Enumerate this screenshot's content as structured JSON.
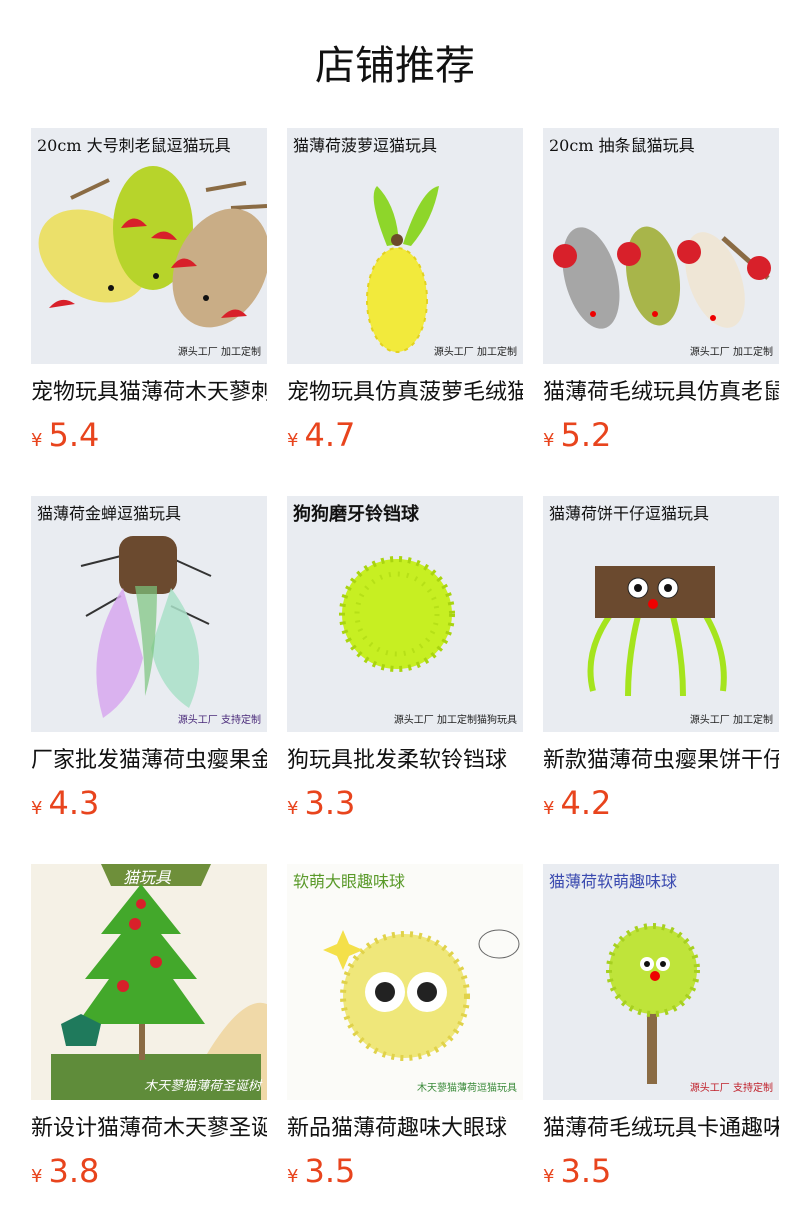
{
  "header": {
    "title": "店铺推荐"
  },
  "currency": "¥",
  "products": [
    {
      "caption": "20cm 大号刺老鼠逗猫玩具",
      "watermark": "源头工厂 加工定制",
      "name": "宠物玩具猫薄荷木天蓼刺老鼠",
      "price": "5.4",
      "icon": "hedgehog-mice-image"
    },
    {
      "caption": "猫薄荷菠萝逗猫玩具",
      "watermark": "源头工厂 加工定制",
      "name": "宠物玩具仿真菠萝毛绒猫薄荷",
      "price": "4.7",
      "icon": "pineapple-toy-image"
    },
    {
      "caption": "20cm 抽条鼠猫玩具",
      "watermark": "源头工厂 加工定制",
      "name": "猫薄荷毛绒玩具仿真老鼠",
      "price": "5.2",
      "icon": "striped-mice-image"
    },
    {
      "caption": "猫薄荷金蝉逗猫玩具",
      "watermark": "源头工厂 支持定制",
      "name": "厂家批发猫薄荷虫瘿果金蝉",
      "price": "4.3",
      "icon": "cicada-toy-image"
    },
    {
      "caption": "狗狗磨牙铃铛球",
      "watermark": "源头工厂 加工定制猫狗玩具",
      "name": "狗玩具批发柔软铃铛球",
      "price": "3.3",
      "icon": "green-ball-image"
    },
    {
      "caption": "猫薄荷饼干仔逗猫玩具",
      "watermark": "源头工厂 加工定制",
      "name": "新款猫薄荷虫瘿果饼干仔",
      "price": "4.2",
      "icon": "biscuit-toy-image"
    },
    {
      "caption": "猫玩具",
      "watermark": "木天蓼猫薄荷圣诞树",
      "name": "新设计猫薄荷木天蓼圣诞树",
      "price": "3.8",
      "icon": "christmas-tree-image"
    },
    {
      "caption": "软萌大眼趣味球",
      "watermark": "木天蓼猫薄荷逗猫玩具",
      "name": "新品猫薄荷趣味大眼球",
      "price": "3.5",
      "icon": "big-eye-ball-image"
    },
    {
      "caption": "猫薄荷软萌趣味球",
      "watermark": "源头工厂 支持定制",
      "name": "猫薄荷毛绒玩具卡通趣味球",
      "price": "3.5",
      "icon": "fluffy-ball-image"
    }
  ]
}
